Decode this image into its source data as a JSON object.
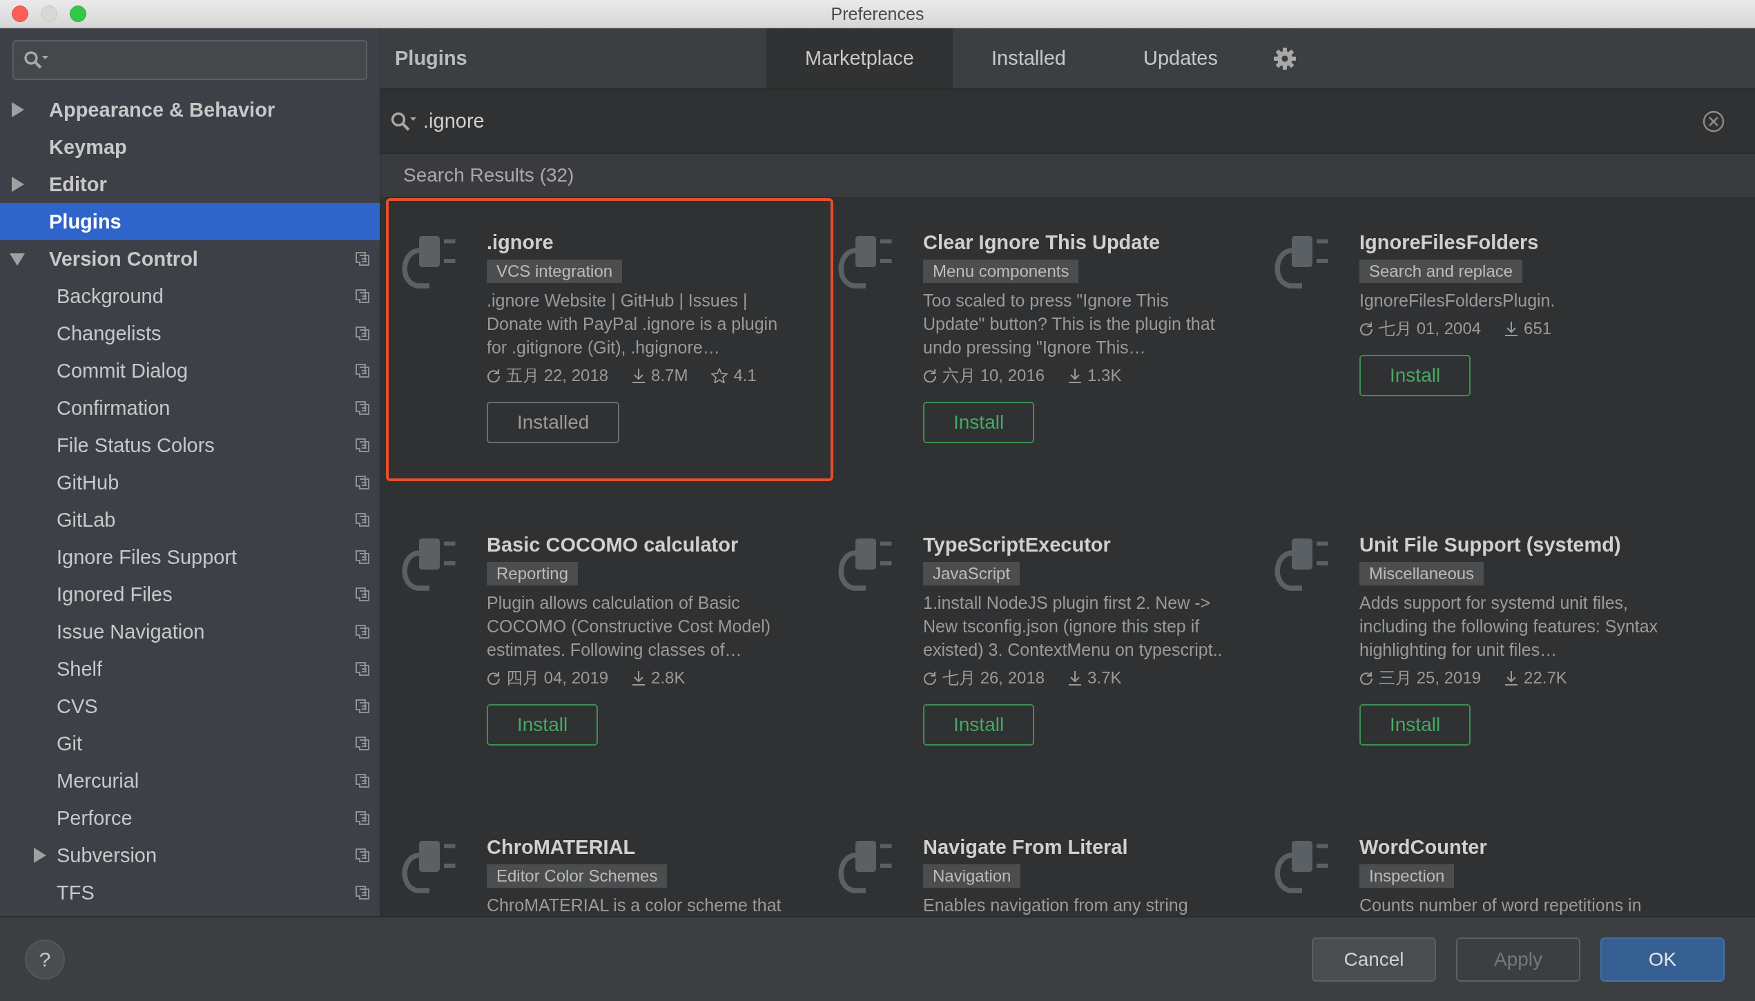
{
  "window": {
    "title": "Preferences"
  },
  "sidebar": {
    "items": [
      {
        "label": "Appearance & Behavior",
        "kind": "group",
        "expanded": false,
        "selected": false,
        "project_level": false
      },
      {
        "label": "Keymap",
        "kind": "leaf",
        "selected": false,
        "project_level": false
      },
      {
        "label": "Editor",
        "kind": "group",
        "expanded": false,
        "selected": false,
        "project_level": false
      },
      {
        "label": "Plugins",
        "kind": "leaf",
        "selected": true,
        "project_level": false
      },
      {
        "label": "Version Control",
        "kind": "group",
        "expanded": true,
        "selected": false,
        "project_level": true,
        "children": [
          {
            "label": "Background",
            "kind": "leaf",
            "selected": false,
            "project_level": true
          },
          {
            "label": "Changelists",
            "kind": "leaf",
            "selected": false,
            "project_level": true
          },
          {
            "label": "Commit Dialog",
            "kind": "leaf",
            "selected": false,
            "project_level": true
          },
          {
            "label": "Confirmation",
            "kind": "leaf",
            "selected": false,
            "project_level": true
          },
          {
            "label": "File Status Colors",
            "kind": "leaf",
            "selected": false,
            "project_level": true
          },
          {
            "label": "GitHub",
            "kind": "leaf",
            "selected": false,
            "project_level": true
          },
          {
            "label": "GitLab",
            "kind": "leaf",
            "selected": false,
            "project_level": true
          },
          {
            "label": "Ignore Files Support",
            "kind": "leaf",
            "selected": false,
            "project_level": true
          },
          {
            "label": "Ignored Files",
            "kind": "leaf",
            "selected": false,
            "project_level": true
          },
          {
            "label": "Issue Navigation",
            "kind": "leaf",
            "selected": false,
            "project_level": true
          },
          {
            "label": "Shelf",
            "kind": "leaf",
            "selected": false,
            "project_level": true
          },
          {
            "label": "CVS",
            "kind": "leaf",
            "selected": false,
            "project_level": true
          },
          {
            "label": "Git",
            "kind": "leaf",
            "selected": false,
            "project_level": true
          },
          {
            "label": "Mercurial",
            "kind": "leaf",
            "selected": false,
            "project_level": true
          },
          {
            "label": "Perforce",
            "kind": "leaf",
            "selected": false,
            "project_level": true
          },
          {
            "label": "Subversion",
            "kind": "group",
            "expanded": false,
            "selected": false,
            "project_level": true
          },
          {
            "label": "TFS",
            "kind": "leaf",
            "selected": false,
            "project_level": true
          }
        ]
      }
    ]
  },
  "header": {
    "title": "Plugins",
    "tabs": [
      {
        "label": "Marketplace",
        "selected": true
      },
      {
        "label": "Installed",
        "selected": false
      },
      {
        "label": "Updates",
        "selected": false
      }
    ]
  },
  "search": {
    "value": ".ignore"
  },
  "results_header": "Search Results (32)",
  "plugins": [
    {
      "name": ".ignore",
      "category": "VCS integration",
      "description": ".ignore Website | GitHub | Issues | Donate with PayPal .ignore is a plugin for .gitignore (Git), .hgignore…",
      "date": "五月 22, 2018",
      "downloads": "8.7M",
      "rating": "4.1",
      "action": {
        "label": "Installed",
        "kind": "installed"
      },
      "highlighted": true
    },
    {
      "name": "Clear Ignore This Update",
      "category": "Menu components",
      "description": "Too scaled to press \"Ignore This Update\" button? This is the plugin that undo pressing \"Ignore This…",
      "date": "六月 10, 2016",
      "downloads": "1.3K",
      "action": {
        "label": "Install",
        "kind": "install"
      },
      "highlighted": false
    },
    {
      "name": "IgnoreFilesFolders",
      "category": "Search and replace",
      "description": "IgnoreFilesFoldersPlugin.",
      "date": "七月 01, 2004",
      "downloads": "651",
      "action": {
        "label": "Install",
        "kind": "install"
      },
      "highlighted": false
    },
    {
      "name": "Basic COCOMO calculator",
      "category": "Reporting",
      "description": "Plugin allows calculation of Basic COCOMO (Constructive Cost Model) estimates. Following classes of…",
      "date": "四月 04, 2019",
      "downloads": "2.8K",
      "action": {
        "label": "Install",
        "kind": "install"
      },
      "highlighted": false
    },
    {
      "name": "TypeScriptExecutor",
      "category": "JavaScript",
      "description": "1.install NodeJS plugin first 2. New -> New tsconfig.json (ignore this step if existed) 3. ContextMenu on typescript..",
      "date": "七月 26, 2018",
      "downloads": "3.7K",
      "action": {
        "label": "Install",
        "kind": "install"
      },
      "highlighted": false
    },
    {
      "name": "Unit File Support (systemd)",
      "category": "Miscellaneous",
      "description": "Adds support for systemd unit files, including the following features: Syntax highlighting for unit files…",
      "date": "三月 25, 2019",
      "downloads": "22.7K",
      "action": {
        "label": "Install",
        "kind": "install"
      },
      "highlighted": false
    },
    {
      "name": "ChroMATERIAL",
      "category": "Editor Color Schemes",
      "description": "ChroMATERIAL is a color scheme that",
      "highlighted": false
    },
    {
      "name": "Navigate From Literal",
      "category": "Navigation",
      "description": "Enables navigation from any string",
      "highlighted": false
    },
    {
      "name": "WordCounter",
      "category": "Inspection",
      "description": "Counts number of word repetitions in",
      "highlighted": false
    }
  ],
  "footer": {
    "help": "?",
    "buttons": [
      {
        "label": "Cancel",
        "kind": "normal",
        "disabled": false
      },
      {
        "label": "Apply",
        "kind": "normal",
        "disabled": true
      },
      {
        "label": "OK",
        "kind": "default",
        "disabled": false
      }
    ]
  }
}
